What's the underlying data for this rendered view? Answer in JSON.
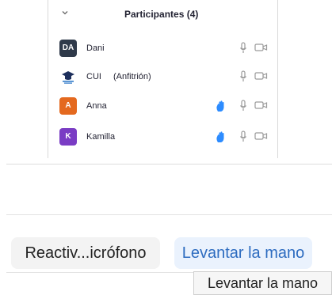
{
  "participants_panel": {
    "title": "Participantes (4)",
    "collapse_icon": "chevron-down-icon",
    "participants": [
      {
        "initials": "DA",
        "name": "Dani",
        "role": "",
        "avatar_color": "#2f3a4a",
        "hand_raised": false
      },
      {
        "initials": "",
        "name": "CUI",
        "role": "(Anfitrión)",
        "avatar_color": "#ffffff",
        "avatar_icon": "graduation-cap-logo-icon",
        "hand_raised": false
      },
      {
        "initials": "A",
        "name": "Anna",
        "role": "",
        "avatar_color": "#e4691f",
        "hand_raised": true
      },
      {
        "initials": "K",
        "name": "Kamilla",
        "role": "",
        "avatar_color": "#7a3cc4",
        "hand_raised": true
      }
    ],
    "icons": {
      "hand": "raised-hand-icon",
      "mic": "microphone-icon",
      "camera": "video-camera-icon"
    },
    "hand_color": "#2d8cff"
  },
  "controls": {
    "mic_button_label": "Reactiv...icrófono",
    "raise_hand_button_label": "Levantar la mano",
    "tooltip": "Levantar la mano",
    "accent_color": "#2d6cc0"
  }
}
